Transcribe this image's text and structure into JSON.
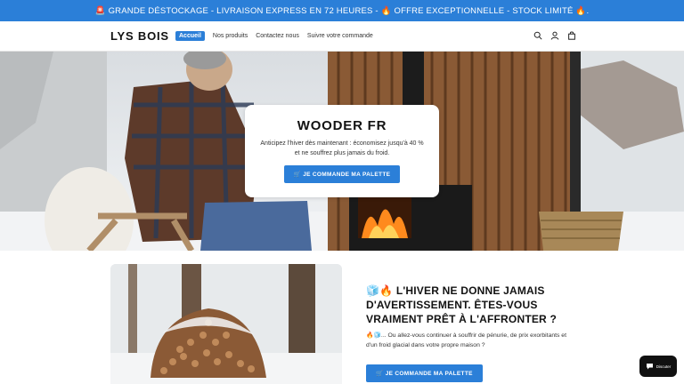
{
  "announcement": {
    "text": "🚨 GRANDE DÉSTOCKAGE - LIVRAISON EXPRESS EN 72 HEURES - 🔥 OFFRE EXCEPTIONNELLE - STOCK LIMITÉ 🔥."
  },
  "header": {
    "logo": "LYS BOIS",
    "nav": [
      "Accueil",
      "Nos produits",
      "Contactez nous",
      "Suivre votre commande"
    ],
    "icons": [
      "search-icon",
      "account-icon",
      "cart-icon"
    ]
  },
  "hero": {
    "title": "WOODER FR",
    "text": "Anticipez l'hiver dès maintenant : économisez jusqu'à 40 % et ne souffrez plus jamais du froid.",
    "button": "🛒 JE COMMANDE MA PALETTE"
  },
  "section": {
    "title": "🧊🔥 L'HIVER NE DONNE JAMAIS D'AVERTISSEMENT. ÊTES-VOUS VRAIMENT PRÊT À L'AFFRONTER ?",
    "text": "🔥🧊... Ou allez-vous continuer à souffrir de pénurie, de prix exorbitants et d'un froid glacial dans votre propre maison ?",
    "button": "🛒 JE COMMANDE MA PALETTE"
  },
  "chat": {
    "label": "Discuter",
    "icon": "chat-bubble-icon"
  },
  "colors": {
    "accent": "#2b7fd8",
    "text": "#121212",
    "announcement_bg": "#2b7fd8"
  }
}
